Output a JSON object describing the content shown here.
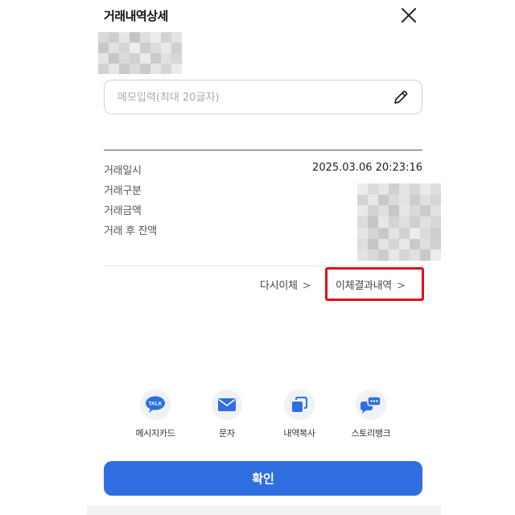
{
  "header": {
    "title": "거래내역상세"
  },
  "memo": {
    "placeholder": "메모입력(최대 20글자)",
    "value": ""
  },
  "details": {
    "labels": [
      "거래일시",
      "거래구분",
      "거래금액",
      "거래 후 잔액"
    ],
    "datetime": "2025.03.06  20:23:16"
  },
  "links": {
    "transfer_again": "다시이체",
    "transfer_result": "이체결과내역",
    "chevron": ">"
  },
  "share": [
    {
      "label": "메시지카드",
      "icon": "talk-bubble-icon",
      "badge": "TALK"
    },
    {
      "label": "문자",
      "icon": "envelope-icon"
    },
    {
      "label": "내역복사",
      "icon": "copy-icon"
    },
    {
      "label": "스토리뱅크",
      "icon": "chat-bubbles-icon"
    }
  ],
  "confirm_label": "확인",
  "colors": {
    "primary": "#2f6ee0",
    "highlight": "#e0101a",
    "icon_circle": "#eef1f5"
  },
  "redacted": {
    "top_shades": [
      "#d9d9d9",
      "#cfcfcf",
      "#e6e6e6",
      "#c4c4c4",
      "#dedede",
      "#ececec",
      "#d2d2d2",
      "#e3e3e3",
      "#c8c8c8",
      "#e1e1e1",
      "#d5d5d5",
      "#ededed",
      "#cdcdcd",
      "#dcdcdc",
      "#e8e8e8",
      "#d0d0d0",
      "#e4e4e4",
      "#c6c6c6",
      "#dadada",
      "#d1d1d1",
      "#eaeaea",
      "#cbcbcb",
      "#dfdfdf",
      "#d7d7d7",
      "#d3d3d3",
      "#e7e7e7",
      "#cacaca",
      "#dbdbdb",
      "#c9c9c9",
      "#e5e5e5",
      "#d6d6d6",
      "#ebebeb"
    ],
    "amount_shades": [
      "#ececec",
      "#dcdcdc",
      "#e6e6e6",
      "#d0d0d0",
      "#e3e3e3",
      "#d8d8d8",
      "#eaeaea",
      "#dedede",
      "#d4d4d4",
      "#e8e8e8",
      "#c9c9c9",
      "#dadada",
      "#e4e4e4",
      "#cdcdcd",
      "#e0e0e0",
      "#d6d6d6",
      "#e9e9e9",
      "#d2d2d2",
      "#dfdfdf",
      "#c7c7c7",
      "#e5e5e5",
      "#d9d9d9",
      "#cbcbcb",
      "#e2e2e2",
      "#dbdbdb",
      "#c5c5c5",
      "#e7e7e7",
      "#d3d3d3",
      "#dedede",
      "#cfcfcf",
      "#e1e1e1",
      "#d7d7d7",
      "#e6e6e6",
      "#d5d5d5",
      "#c8c8c8",
      "#e3e3e3",
      "#d1d1d1",
      "#ebebeb",
      "#dadada",
      "#cecece",
      "#dddddd",
      "#c6c6c6",
      "#e4e4e4",
      "#d4d4d4",
      "#e8e8e8",
      "#cacaca",
      "#dfdfdf",
      "#d0d0d0",
      "#e2e2e2",
      "#d9d9d9",
      "#cccccc",
      "#e7e7e7",
      "#d6d6d6",
      "#e0e0e0",
      "#c9c9c9",
      "#ececec"
    ]
  }
}
